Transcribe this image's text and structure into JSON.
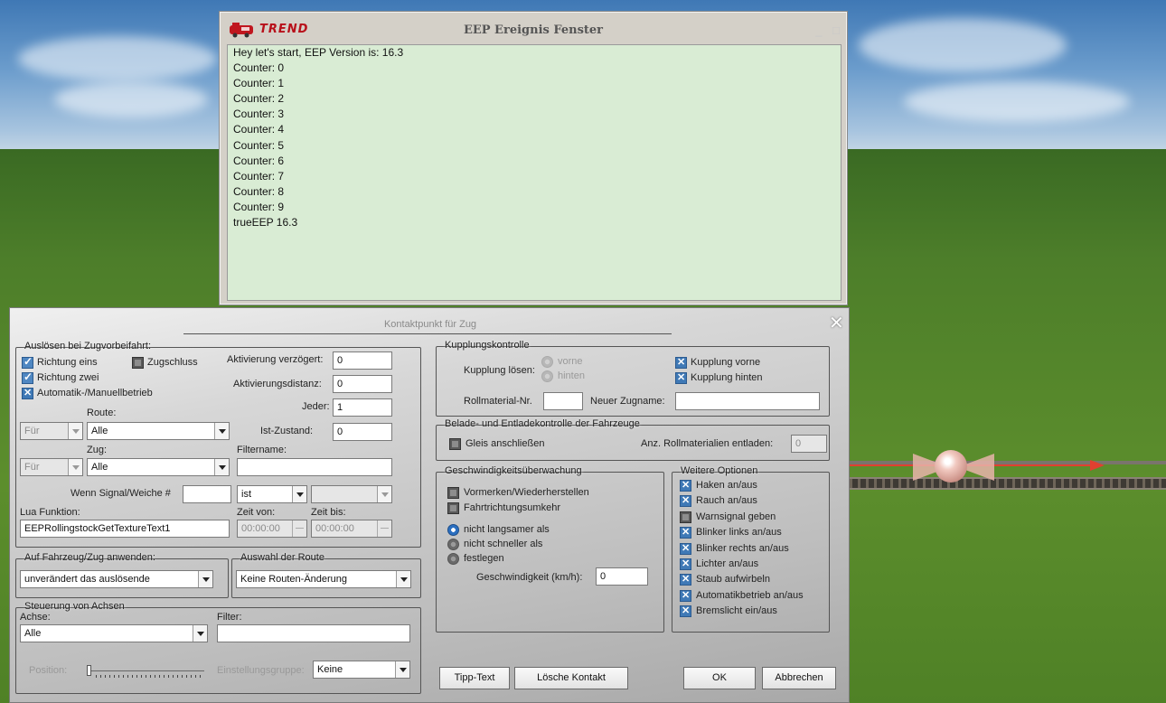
{
  "event_window": {
    "logo_text": "TREND",
    "title": "EEP Ereignis Fenster",
    "minimize": "_",
    "maximize": "□",
    "lines": [
      "Hey let's start, EEP Version is: 16.3",
      "Counter: 0",
      "Counter: 1",
      "Counter: 2",
      "Counter: 3",
      "Counter: 4",
      "Counter: 5",
      "Counter: 6",
      "Counter: 7",
      "Counter: 8",
      "Counter: 9",
      "trueEEP 16.3"
    ]
  },
  "dialog": {
    "title": "Kontaktpunkt für Zug",
    "close": "✕",
    "trigger": {
      "legend": "Auslösen bei Zugvorbeifahrt:",
      "richtung_eins": "Richtung eins",
      "zugschluss": "Zugschluss",
      "richtung_zwei": "Richtung zwei",
      "automatik": "Automatik-/Manuellbetrieb",
      "aktivierung_verzoegert_label": "Aktivierung verzögert:",
      "aktivierung_verzoegert_value": "0",
      "aktivierungsdistanz_label": "Aktivierungsdistanz:",
      "aktivierungsdistanz_value": "0",
      "jeder_label": "Jeder:",
      "jeder_value": "1",
      "route_label": "Route:",
      "fuer1": "Für",
      "route_value": "Alle",
      "ist_zustand_label": "Ist-Zustand:",
      "ist_zustand_value": "0",
      "zug_label": "Zug:",
      "filtername_label": "Filtername:",
      "fuer2": "Für",
      "zug_value": "Alle",
      "filtername_value": "",
      "signal_label": "Wenn Signal/Weiche #",
      "signal_value": "",
      "ist_value": "ist",
      "signal_state": "",
      "lua_label": "Lua Funktion:",
      "lua_value": "EEPRollingstockGetTextureText1",
      "zeit_von_label": "Zeit von:",
      "zeit_von_value": "00:00:00",
      "zeit_bis_label": "Zeit bis:",
      "zeit_bis_value": "00:00:00"
    },
    "apply": {
      "legend": "Auf Fahrzeug/Zug anwenden:",
      "value": "unverändert das auslösende"
    },
    "route_choice": {
      "legend": "Auswahl der Route",
      "value": "Keine Routen-Änderung"
    },
    "axes": {
      "legend": "Steuerung von Achsen",
      "achse_label": "Achse:",
      "achse_value": "Alle",
      "filter_label": "Filter:",
      "filter_value": "",
      "position_label": "Position:",
      "position_level": 0.0,
      "gruppe_label": "Einstellungsgruppe:",
      "gruppe_value": "Keine"
    },
    "coupling": {
      "legend": "Kupplungskontrolle",
      "loesen_label": "Kupplung lösen:",
      "vorne": "vorne",
      "hinten": "hinten",
      "kupplung_vorne": "Kupplung vorne",
      "kupplung_hinten": "Kupplung hinten",
      "rollmaterial_label": "Rollmaterial-Nr.",
      "rollmaterial_value": "",
      "zugname_label": "Neuer Zugname:",
      "zugname_value": ""
    },
    "loading": {
      "legend": "Belade- und Entladekontrolle der Fahrzeuge",
      "gleis": "Gleis anschließen",
      "anz_label": "Anz. Rollmaterialien entladen:",
      "anz_value": "0"
    },
    "speed": {
      "legend": "Geschwindigkeitsüberwachung",
      "vormerken": "Vormerken/Wiederherstellen",
      "umkehr": "Fahrtrichtungsumkehr",
      "nicht_langsamer": "nicht langsamer als",
      "nicht_schneller": "nicht schneller als",
      "festlegen": "festlegen",
      "geschw_label": "Geschwindigkeit (km/h):",
      "geschw_value": "0"
    },
    "options": {
      "legend": "Weitere Optionen",
      "items": [
        "Haken an/aus",
        "Rauch an/aus",
        "Warnsignal geben",
        "Blinker links an/aus",
        "Blinker rechts an/aus",
        "Lichter an/aus",
        "Staub aufwirbeln",
        "Automatikbetrieb an/aus",
        "Bremslicht ein/aus"
      ]
    },
    "buttons": {
      "tipp": "Tipp-Text",
      "loesche": "Lösche Kontakt",
      "ok": "OK",
      "abbrechen": "Abbrechen"
    }
  },
  "colors": {
    "event_bg": "#d9ecd4",
    "trend_red": "#b8101a",
    "checkbox_blue": "#3f79b6"
  }
}
